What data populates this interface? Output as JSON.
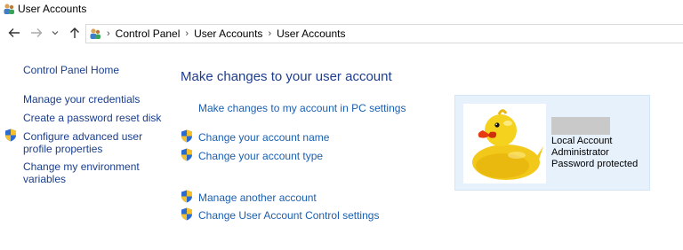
{
  "window": {
    "title": "User Accounts"
  },
  "nav": {
    "back": "back-arrow-icon",
    "forward": "forward-arrow-icon",
    "recent": "chevron-down-icon",
    "up": "up-arrow-icon"
  },
  "breadcrumb": {
    "items": [
      "Control Panel",
      "User Accounts",
      "User Accounts"
    ],
    "separator": "›"
  },
  "sidebar": {
    "home": "Control Panel Home",
    "items": [
      {
        "label": "Manage your credentials",
        "shield": false
      },
      {
        "label": "Create a password reset disk",
        "shield": false
      },
      {
        "label": "Configure advanced user profile properties",
        "label_line1": "Configure advanced user",
        "label_line2": "profile properties",
        "shield": true
      },
      {
        "label": "Change my environment variables",
        "label_line1": "Change my environment",
        "label_line2": "variables",
        "shield": false
      }
    ]
  },
  "main": {
    "heading": "Make changes to your user account",
    "links": [
      {
        "label": "Make changes to my account in PC settings",
        "shield": false
      },
      {
        "label": "Change your account name",
        "shield": true
      },
      {
        "label": "Change your account type",
        "shield": true
      },
      {
        "label": "Manage another account",
        "shield": true
      },
      {
        "label": "Change User Account Control settings",
        "shield": true
      }
    ]
  },
  "account": {
    "type": "Local Account",
    "role": "Administrator",
    "protection": "Password protected",
    "avatar": "rubber-duck"
  },
  "colors": {
    "link": "#1a5fb0",
    "heading": "#1e3d8f",
    "card_bg": "#e6f1fb",
    "shield_blue": "#2b6bd1",
    "shield_yellow": "#f4c02b"
  }
}
